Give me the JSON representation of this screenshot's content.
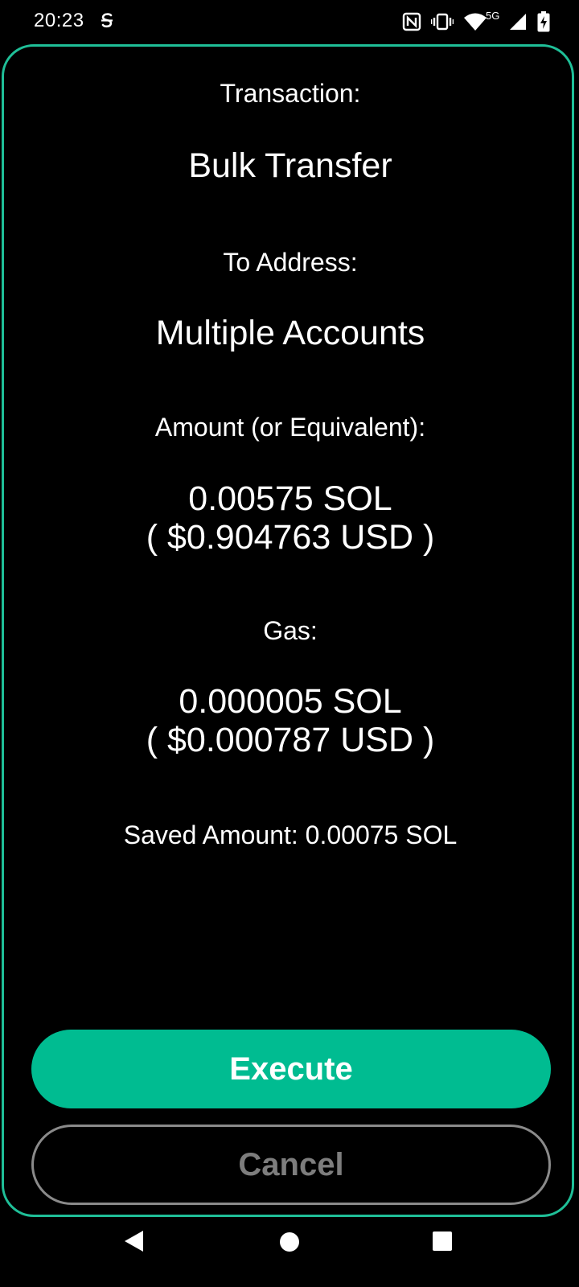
{
  "status_bar": {
    "time": "20:23",
    "network_label": "5G",
    "icons": [
      "s-circle-icon",
      "nfc-icon",
      "vibrate-icon",
      "wifi-icon",
      "signal-icon",
      "battery-charging-icon"
    ]
  },
  "transaction": {
    "label": "Transaction:",
    "value": "Bulk Transfer"
  },
  "to_address": {
    "label": "To Address:",
    "value": "Multiple Accounts"
  },
  "amount": {
    "label": "Amount (or Equivalent):",
    "value_sol": "0.00575 SOL",
    "value_usd": "( $0.904763 USD )"
  },
  "gas": {
    "label": "Gas:",
    "value_sol": "0.000005 SOL",
    "value_usd": "( $0.000787 USD )"
  },
  "saved": {
    "text": "Saved Amount: 0.00075 SOL"
  },
  "buttons": {
    "execute_label": "Execute",
    "cancel_label": "Cancel"
  },
  "colors": {
    "accent": "#00bc91",
    "card_border": "#1fbf98",
    "cancel_border": "#8a8a8a",
    "background": "#000000"
  },
  "nav_bar": {
    "icons": [
      "back-icon",
      "home-icon",
      "recents-icon"
    ]
  }
}
